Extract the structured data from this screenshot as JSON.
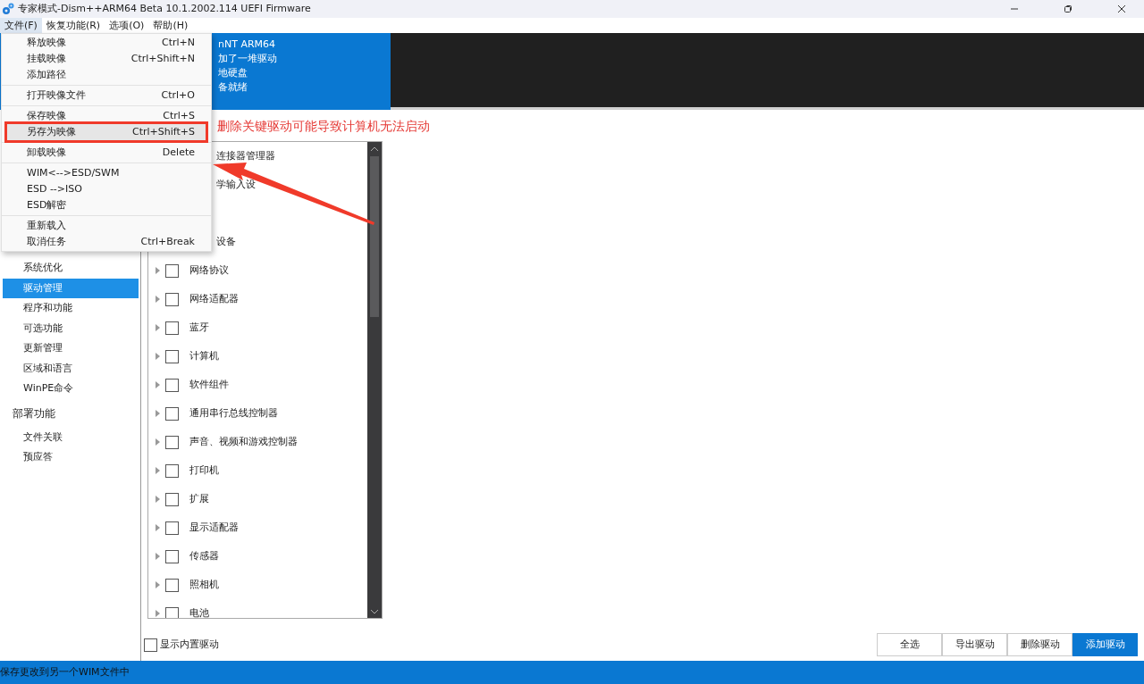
{
  "window": {
    "title": "专家模式-Dism++ARM64 Beta 10.1.2002.114 UEFI Firmware"
  },
  "menu_bar": [
    {
      "label": "文件(F)",
      "selected": true
    },
    {
      "label": "恢复功能(R)",
      "selected": false
    },
    {
      "label": "选项(O)",
      "selected": false
    },
    {
      "label": "帮助(H)",
      "selected": false
    }
  ],
  "file_menu": [
    [
      {
        "label": "释放映像",
        "shortcut": "Ctrl+N",
        "selected": false
      },
      {
        "label": "挂载映像",
        "shortcut": "Ctrl+Shift+N",
        "selected": false
      },
      {
        "label": "添加路径",
        "selected": false
      }
    ],
    [
      {
        "label": "打开映像文件",
        "shortcut": "Ctrl+O",
        "selected": false
      }
    ],
    [
      {
        "label": "保存映像",
        "shortcut": "Ctrl+S",
        "selected": false
      },
      {
        "label": "另存为映像",
        "shortcut": "Ctrl+Shift+S",
        "selected": true
      }
    ],
    [
      {
        "label": "卸载映像",
        "shortcut": "Delete",
        "selected": false
      }
    ],
    [
      {
        "label": "WIM<-->ESD/SWM",
        "selected": false
      },
      {
        "label": "ESD -->ISO",
        "selected": false
      },
      {
        "label": "ESD解密",
        "selected": false
      }
    ],
    [
      {
        "label": "重新载入",
        "selected": false
      },
      {
        "label": "取消任务",
        "shortcut": "Ctrl+Break",
        "selected": false
      }
    ]
  ],
  "banner": {
    "lines": [
      "nNT ARM64",
      "加了一堆驱动",
      "地硬盘",
      "备就绪"
    ]
  },
  "sidebar": [
    {
      "label": "系统优化",
      "kind": "item",
      "selected": false
    },
    {
      "label": "驱动管理",
      "kind": "item",
      "selected": true
    },
    {
      "label": "程序和功能",
      "kind": "item",
      "selected": false
    },
    {
      "label": "可选功能",
      "kind": "item",
      "selected": false
    },
    {
      "label": "更新管理",
      "kind": "item",
      "selected": false
    },
    {
      "label": "区域和语言",
      "kind": "item",
      "selected": false
    },
    {
      "label": "WinPE命令",
      "kind": "item",
      "selected": false
    },
    {
      "label": "部署功能",
      "kind": "section"
    },
    {
      "label": "文件关联",
      "kind": "item",
      "selected": false
    },
    {
      "label": "预应答",
      "kind": "item",
      "selected": false
    }
  ],
  "warning": "删除关键驱动可能导致计算机无法启动",
  "driver_list": [
    {
      "kind": "partial",
      "label": "连接器管理器"
    },
    {
      "kind": "partial",
      "label": "学输入设"
    },
    {
      "kind": "hidden"
    },
    {
      "kind": "partial",
      "label": "设备"
    },
    {
      "kind": "full",
      "label": "网络协议",
      "checked": false
    },
    {
      "kind": "full",
      "label": "网络适配器",
      "checked": false
    },
    {
      "kind": "full",
      "label": "蓝牙",
      "checked": false
    },
    {
      "kind": "full",
      "label": "计算机",
      "checked": false
    },
    {
      "kind": "full",
      "label": "软件组件",
      "checked": false
    },
    {
      "kind": "full",
      "label": "通用串行总线控制器",
      "checked": false
    },
    {
      "kind": "full",
      "label": "声音、视频和游戏控制器",
      "checked": false
    },
    {
      "kind": "full",
      "label": "打印机",
      "checked": false
    },
    {
      "kind": "full",
      "label": "扩展",
      "checked": false
    },
    {
      "kind": "full",
      "label": "显示适配器",
      "checked": false
    },
    {
      "kind": "full",
      "label": "传感器",
      "checked": false
    },
    {
      "kind": "full",
      "label": "照相机",
      "checked": false
    },
    {
      "kind": "full",
      "label": "电池",
      "checked": false
    }
  ],
  "show_builtin": {
    "label": "显示内置驱动",
    "checked": false
  },
  "buttons": [
    {
      "label": "全选",
      "primary": false
    },
    {
      "label": "导出驱动",
      "primary": false
    },
    {
      "label": "删除驱动",
      "primary": false
    },
    {
      "label": "添加驱动",
      "primary": true
    }
  ],
  "status_bar": "保存更改到另一个WIM文件中"
}
